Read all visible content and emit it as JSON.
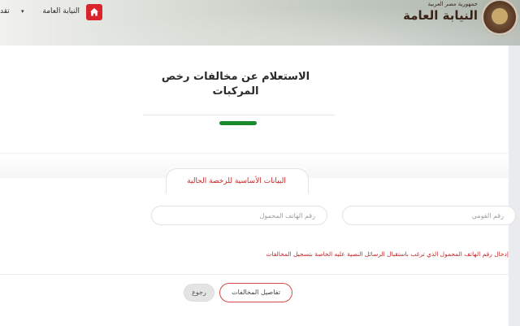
{
  "header": {
    "org_subtitle": "جمهورية مصر العربية",
    "org_title": "النيابة العامة",
    "home_icon": "home-icon",
    "nav_item_label": "النيابة العامة",
    "nav_caret": "▾",
    "nav_item_cut_label": "تقد"
  },
  "main": {
    "page_title": "الاستعلام عن مخالفات رخص المركبات",
    "section_title": "البيانات الأساسية للرخصة الحالية",
    "fields": {
      "mobile_placeholder": "رقم الهاتف المحمول",
      "national_id_placeholder": "رقم القومي"
    },
    "hint": "إدخال رقم الهاتف المحمول الذي ترغب باستقبال الرسائل النصية عليه الخاصة بتسجيل المخالفات",
    "buttons": {
      "details_label": "تفاصيل المخالفات",
      "back_label": "رجوع"
    }
  },
  "colors": {
    "accent_red": "#d9242b",
    "accent_green": "#1a8a2e",
    "text_red": "#c62828"
  }
}
